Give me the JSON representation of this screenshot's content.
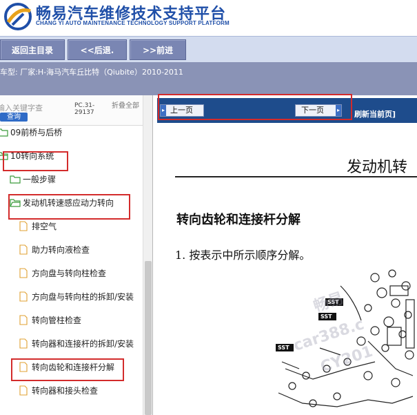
{
  "header": {
    "title": "畅易汽车维修技术支持平台",
    "subtitle": "CHANG YI AUTO MAINTENANCE TECHNOLOGY SUPPORT PLATFORM"
  },
  "toolbar": {
    "home_label": "返回主目录",
    "back_label": "<<后退.",
    "forward_label": ">>前进"
  },
  "vehicle": {
    "text": "车型:  厂家:H-海马汽车丘比特（Qiubite）2010-2011"
  },
  "sidebar": {
    "search_hint": "输入关键字查",
    "search_button": "查询",
    "pc_code": "PC.31-29137",
    "collapse_all": "折叠全部",
    "items": [
      {
        "label": "09前桥与后桥",
        "type": "folder"
      },
      {
        "label": "10转向系统",
        "type": "folder-open"
      },
      {
        "label": "一般步骤",
        "type": "folder"
      },
      {
        "label": "发动机转速感应动力转向",
        "type": "folder-open"
      },
      {
        "label": "排空气",
        "type": "doc"
      },
      {
        "label": "助力转向液检查",
        "type": "doc"
      },
      {
        "label": "方向盘与转向柱检查",
        "type": "doc"
      },
      {
        "label": "方向盘与转向柱的拆卸/安装",
        "type": "doc"
      },
      {
        "label": "转向管柱检查",
        "type": "doc"
      },
      {
        "label": "转向器和连接杆的拆卸/安装",
        "type": "doc"
      },
      {
        "label": "转向齿轮和连接杆分解",
        "type": "doc"
      },
      {
        "label": "转向器和接头检查",
        "type": "doc"
      }
    ]
  },
  "content_nav": {
    "prev_label": "上一页",
    "next_label": "下一页",
    "refresh_label": "刷新当前页]"
  },
  "document": {
    "heading": "发动机转",
    "section_title": "转向齿轮和连接杆分解",
    "step_1": "1. 按表示中所示顺序分解。",
    "diagram_labels": [
      "SST",
      "SST",
      "SST"
    ],
    "watermark_1": "畅易",
    "watermark_2": "car388.c",
    "watermark_3": "CY201"
  },
  "colors": {
    "brand_blue": "#1f4fa8",
    "toolbar_bg": "#d3dcef",
    "button_bg": "#7a86b3",
    "vehicle_bar": "#8a93b6",
    "nav_bar": "#1e4c8c",
    "highlight_red": "#d32b2b"
  }
}
